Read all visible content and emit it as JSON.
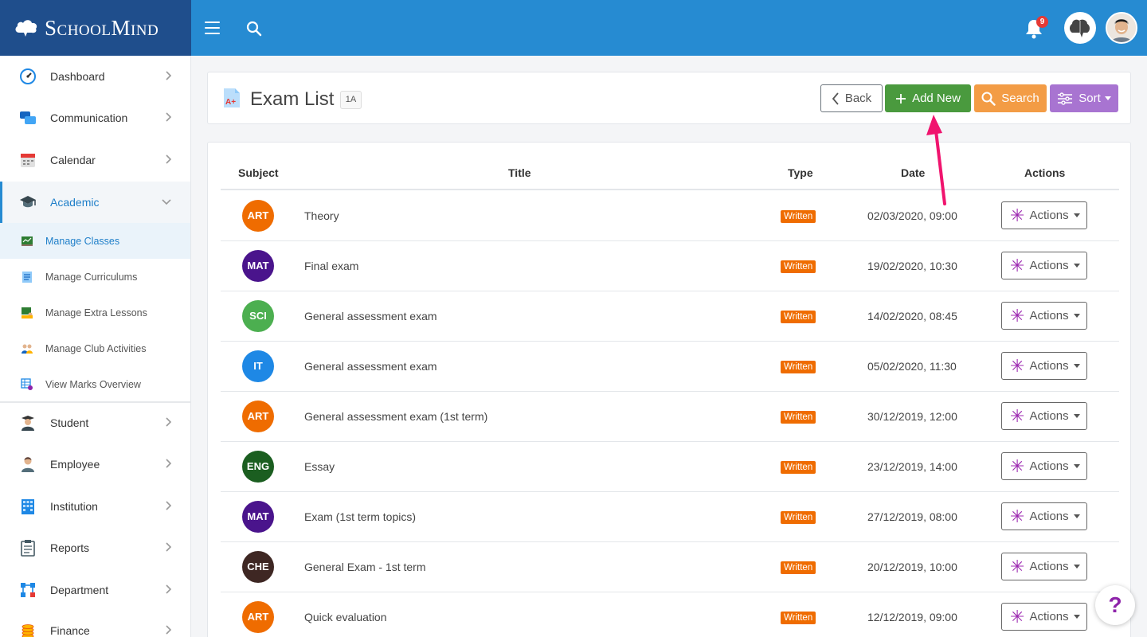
{
  "app": {
    "brand": "SchoolMind",
    "notifications_count": "9"
  },
  "sidebar": {
    "items": [
      {
        "label": "Dashboard",
        "icon": "dashboard-gauge-icon"
      },
      {
        "label": "Communication",
        "icon": "chat-bubbles-icon"
      },
      {
        "label": "Calendar",
        "icon": "calendar-icon"
      },
      {
        "label": "Academic",
        "icon": "graduation-cap-icon",
        "active": true
      },
      {
        "label": "Student",
        "icon": "student-icon"
      },
      {
        "label": "Employee",
        "icon": "employee-icon"
      },
      {
        "label": "Institution",
        "icon": "building-icon"
      },
      {
        "label": "Reports",
        "icon": "clipboard-icon"
      },
      {
        "label": "Department",
        "icon": "org-chart-icon"
      },
      {
        "label": "Finance",
        "icon": "coins-icon"
      }
    ],
    "academic_sub": [
      {
        "label": "Manage Classes",
        "active": true
      },
      {
        "label": "Manage Curriculums"
      },
      {
        "label": "Manage Extra Lessons"
      },
      {
        "label": "Manage Club Activities"
      },
      {
        "label": "View Marks Overview"
      }
    ]
  },
  "header": {
    "title": "Exam List",
    "class_badge": "1A",
    "back_label": "Back",
    "add_label": "Add New",
    "search_label": "Search",
    "sort_label": "Sort"
  },
  "table": {
    "columns": [
      "Subject",
      "Title",
      "Type",
      "Date",
      "Actions"
    ],
    "rows": [
      {
        "subject": "ART",
        "color": "#ef6c00",
        "title": "Theory",
        "type": "Written",
        "date": "02/03/2020, 09:00",
        "action": "Actions"
      },
      {
        "subject": "MAT",
        "color": "#4a148c",
        "title": "Final exam",
        "type": "Written",
        "date": "19/02/2020, 10:30",
        "action": "Actions"
      },
      {
        "subject": "SCI",
        "color": "#4caf50",
        "title": "General assessment exam",
        "type": "Written",
        "date": "14/02/2020, 08:45",
        "action": "Actions"
      },
      {
        "subject": "IT",
        "color": "#1e88e5",
        "title": "General assessment exam",
        "type": "Written",
        "date": "05/02/2020, 11:30",
        "action": "Actions"
      },
      {
        "subject": "ART",
        "color": "#ef6c00",
        "title": "General assessment exam (1st term)",
        "type": "Written",
        "date": "30/12/2019, 12:00",
        "action": "Actions"
      },
      {
        "subject": "ENG",
        "color": "#1b5e20",
        "title": "Essay",
        "type": "Written",
        "date": "23/12/2019, 14:00",
        "action": "Actions"
      },
      {
        "subject": "MAT",
        "color": "#4a148c",
        "title": "Exam (1st term topics)",
        "type": "Written",
        "date": "27/12/2019, 08:00",
        "action": "Actions"
      },
      {
        "subject": "CHE",
        "color": "#3e2723",
        "title": "General Exam - 1st term",
        "type": "Written",
        "date": "20/12/2019, 10:00",
        "action": "Actions"
      },
      {
        "subject": "ART",
        "color": "#ef6c00",
        "title": "Quick evaluation",
        "type": "Written",
        "date": "12/12/2019, 09:00",
        "action": "Actions"
      }
    ]
  },
  "help_label": "?"
}
